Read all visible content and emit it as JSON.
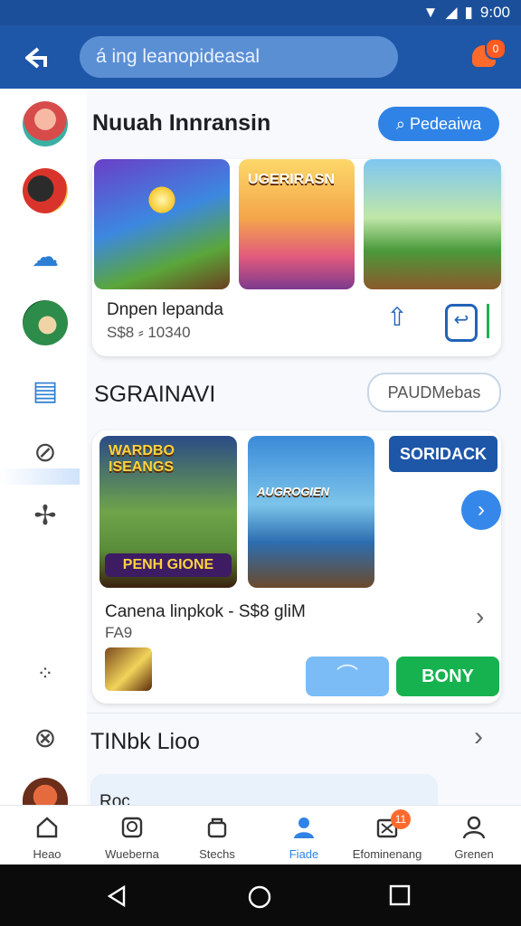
{
  "status_bar": {
    "time": "9:00"
  },
  "header": {
    "search_placeholder": "á ing leanopideasal"
  },
  "notifications": {
    "count": "0"
  },
  "section1": {
    "title": "Nuuah Innransin",
    "button": "Pedeaiwa",
    "thumb2_title": "UGERIRASN",
    "item_title": "Dnpen lepanda",
    "item_sub": "S$8 ⸗ 10340"
  },
  "section2": {
    "title": "SGRAINAVI",
    "button": "PAUDMebas",
    "thumb1_title": "WARDBO ISEANGS",
    "thumb1_banner": "PENH GIONE",
    "thumb2_title": "AUGROGIEN",
    "side_button": "SORIDACK",
    "item_title": "Canena linpkok  -  S$8 gliM",
    "item_sub": "FA9",
    "green_button": "BONY"
  },
  "section3": {
    "title": "TINbk Lioo",
    "card_text": "Roc"
  },
  "bottom_nav": [
    {
      "label": "Heao"
    },
    {
      "label": "Wueberna"
    },
    {
      "label": "Stechs"
    },
    {
      "label": "Fiade"
    },
    {
      "label": "Efominenang",
      "badge": "11"
    },
    {
      "label": "Grenen"
    }
  ],
  "colors": {
    "brand": "#1e56a8",
    "accent": "#2f83e6",
    "green": "#16b24f",
    "badge": "#ff6a2c"
  }
}
